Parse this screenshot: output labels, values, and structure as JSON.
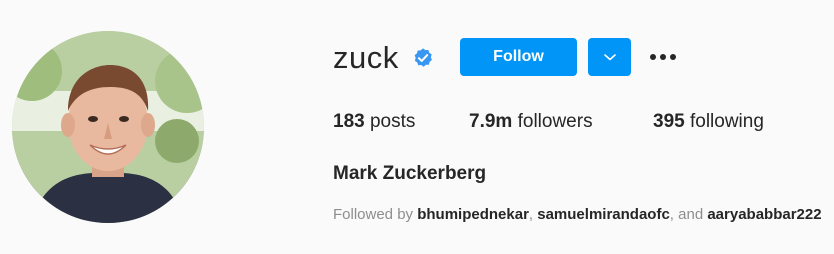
{
  "profile": {
    "username": "zuck",
    "full_name": "Mark Zuckerberg",
    "verified_icon": "verified-badge-icon",
    "avatar_icon": "profile-photo"
  },
  "actions": {
    "follow_label": "Follow",
    "dropdown_icon": "chevron-down-icon",
    "more_icon": "more-options-icon"
  },
  "stats": {
    "posts_count": "183",
    "posts_label": "posts",
    "followers_count": "7.9m",
    "followers_label": "followers",
    "following_count": "395",
    "following_label": "following"
  },
  "followed_by": {
    "prefix": "Followed by",
    "users": [
      "bhumipednekar",
      "samuelmirandaofc",
      "aaryababbar222"
    ],
    "sep1": ",",
    "sep2": ", and"
  },
  "colors": {
    "accent": "#0095f6",
    "background": "#fafafa",
    "text": "#262626",
    "muted": "#8e8e8e"
  }
}
